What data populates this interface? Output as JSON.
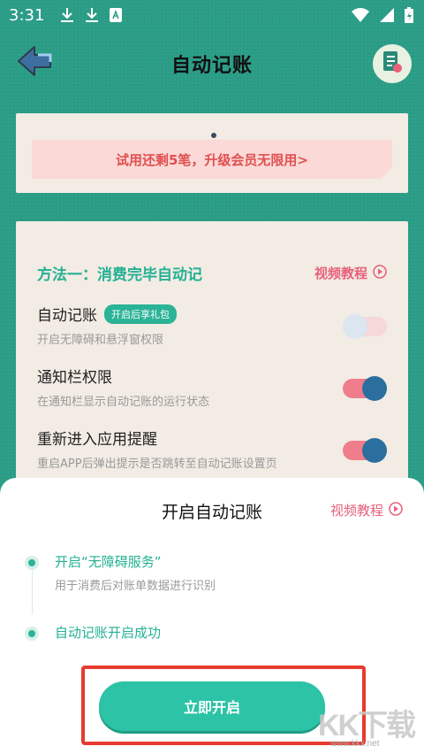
{
  "status_bar": {
    "time": "3:31",
    "icons_left": [
      "download-icon",
      "download-icon",
      "app-notification-icon"
    ],
    "icons_right": [
      "wifi-icon",
      "signal-icon",
      "battery-icon"
    ]
  },
  "header": {
    "title": "自动记账",
    "back_icon": "back-arrow-icon",
    "right_icon": "bill-icon"
  },
  "trial": {
    "text": "试用还剩5笔，升级会员无限用>"
  },
  "method": {
    "title": "方法一：消费完毕自动记",
    "video_label": "视频教程",
    "rows": [
      {
        "title": "自动记账",
        "badge": "开启后享礼包",
        "desc": "开启无障碍和悬浮窗权限",
        "enabled": false
      },
      {
        "title": "通知栏权限",
        "desc": "在通知栏显示自动记账的运行状态",
        "enabled": true
      },
      {
        "title": "重新进入应用提醒",
        "desc": "重启APP后弹出提示是否跳转至自动记账设置页",
        "enabled": true
      }
    ]
  },
  "sheet": {
    "title": "开启自动记账",
    "video_label": "视频教程",
    "steps": [
      {
        "title": "开启“无障碍服务”",
        "desc": "用于消费后对账单数据进行识别"
      },
      {
        "title": "自动记账开启成功"
      }
    ],
    "button_label": "立即开启"
  },
  "watermark": {
    "logo": "KK下载",
    "url": "www.kkx.net"
  },
  "colors": {
    "background": "#2a9c86",
    "accent_green": "#25b094",
    "accent_pink": "#e8607a",
    "trial_red": "#e05050",
    "highlight_red": "#e63b2e"
  }
}
